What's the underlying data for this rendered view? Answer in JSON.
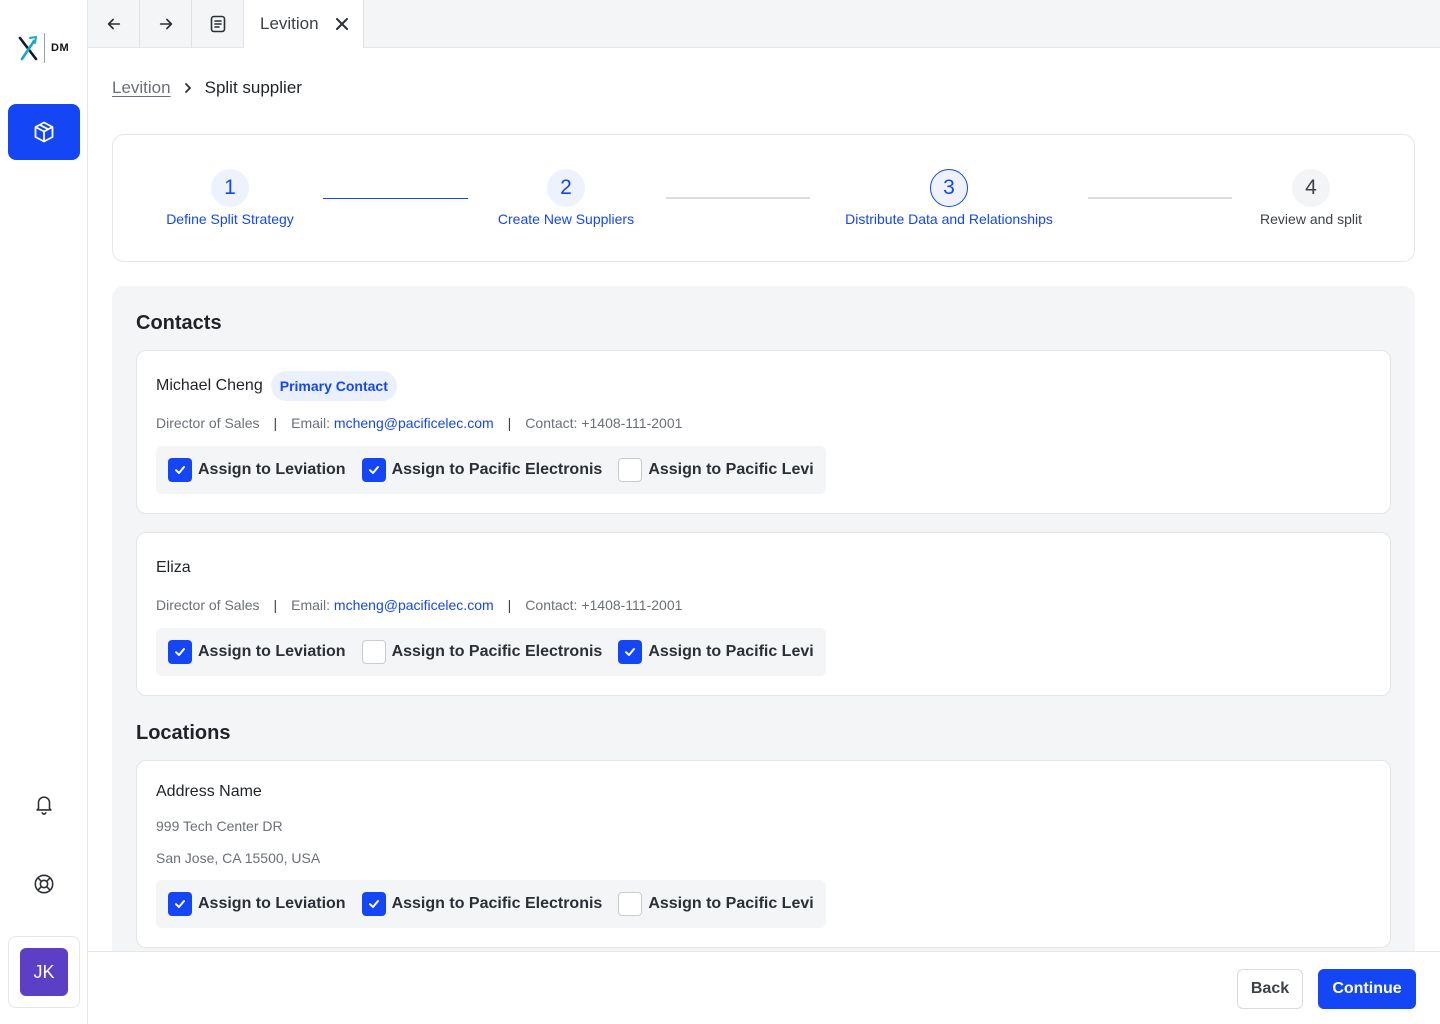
{
  "sidebar": {
    "logo_text": "DM",
    "avatar_initials": "JK"
  },
  "tabbar": {
    "active_tab_label": "Levition"
  },
  "breadcrumb": {
    "parent": "Levition",
    "current": "Split supplier"
  },
  "stepper": {
    "steps": [
      {
        "number": "1",
        "label": "Define Split Strategy",
        "state": "done"
      },
      {
        "number": "2",
        "label": "Create New Suppliers",
        "state": "done"
      },
      {
        "number": "3",
        "label": "Distribute Data and Relationships",
        "state": "active"
      },
      {
        "number": "4",
        "label": "Review and split",
        "state": "pending"
      }
    ]
  },
  "contacts": {
    "title": "Contacts",
    "items": [
      {
        "name": "Michael Cheng",
        "badge": "Primary Contact",
        "role": "Director of Sales",
        "email_label": "Email:",
        "email": "mcheng@pacificelec.com",
        "contact_label": "Contact: +1408-111-2001",
        "assign": [
          {
            "label": "Assign to Leviation",
            "checked": true
          },
          {
            "label": "Assign to Pacific Electronis",
            "checked": true
          },
          {
            "label": "Assign to Pacific Levi",
            "checked": false
          }
        ]
      },
      {
        "name": "Eliza",
        "badge": "",
        "role": "Director of Sales",
        "email_label": "Email:",
        "email": "mcheng@pacificelec.com",
        "contact_label": "Contact: +1408-111-2001",
        "assign": [
          {
            "label": "Assign to Leviation",
            "checked": true
          },
          {
            "label": "Assign to Pacific Electronis",
            "checked": false
          },
          {
            "label": "Assign to Pacific Levi",
            "checked": true
          }
        ]
      }
    ]
  },
  "locations": {
    "title": "Locations",
    "items": [
      {
        "name": "Address Name",
        "line1": "999 Tech Center DR",
        "line2": "San Jose, CA 15500, USA",
        "assign": [
          {
            "label": "Assign to Leviation",
            "checked": true
          },
          {
            "label": "Assign to Pacific Electronis",
            "checked": true
          },
          {
            "label": "Assign to Pacific Levi",
            "checked": false
          }
        ]
      }
    ]
  },
  "footer": {
    "back_label": "Back",
    "continue_label": "Continue"
  },
  "colors": {
    "accent": "#1546f5",
    "avatar": "#5b3fc4"
  }
}
